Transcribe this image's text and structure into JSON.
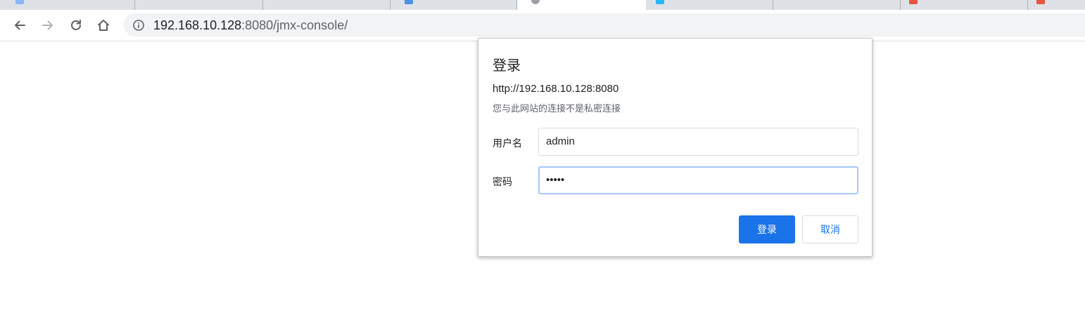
{
  "colors": {
    "accent": "#1a73e8",
    "tabstrip": "#dee1e6",
    "omnibox_bg": "#f1f3f4",
    "focus_ring": "#a8c7fa"
  },
  "toolbar": {
    "back_icon": "arrow-left-icon",
    "forward_icon": "arrow-right-icon",
    "reload_icon": "reload-icon",
    "home_icon": "home-icon",
    "info_icon": "info-circle-icon",
    "url_host": "192.168.10.128",
    "url_rest": ":8080/jmx-console/"
  },
  "dialog": {
    "title": "登录",
    "origin": "http://192.168.10.128:8080",
    "warning": "您与此网站的连接不是私密连接",
    "username_label": "用户名",
    "username_value": "admin",
    "password_label": "密码",
    "password_value": "•••••",
    "login_button": "登录",
    "cancel_button": "取消"
  }
}
